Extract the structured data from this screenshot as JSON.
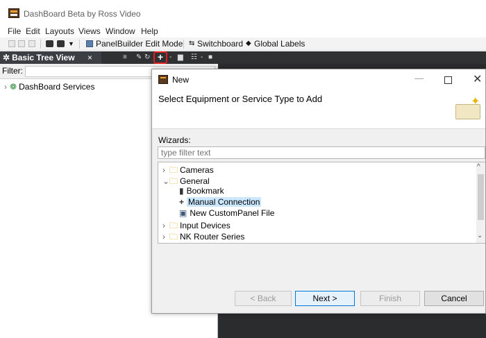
{
  "app": {
    "title": "DashBoard Beta by Ross Video"
  },
  "menu": [
    "File",
    "Edit",
    "Layouts",
    "Views",
    "Window",
    "Help"
  ],
  "toolbar": {
    "panelbuilder": "PanelBuilder Edit Mode",
    "switchboard": "Switchboard",
    "global_labels": "Global Labels"
  },
  "panel": {
    "tab_label": "Basic Tree View",
    "tab_close": "×",
    "filter_label": "Filter:",
    "tree_items": [
      {
        "label": "DashBoard Services"
      }
    ]
  },
  "dialog": {
    "title": "New",
    "heading": "Select Equipment or Service Type to Add",
    "wizards_label": "Wizards:",
    "filter_placeholder": "type filter text",
    "items": [
      {
        "label": "Cameras",
        "type": "folder",
        "expanded": false
      },
      {
        "label": "General",
        "type": "folder",
        "expanded": true
      },
      {
        "label": "Bookmark",
        "type": "bookmark-icon"
      },
      {
        "label": "Manual Connection",
        "type": "plus-icon",
        "selected": true
      },
      {
        "label": "New CustomPanel File",
        "type": "panel-file-icon"
      },
      {
        "label": "Input Devices",
        "type": "folder",
        "expanded": false
      },
      {
        "label": "NK Router Series",
        "type": "folder",
        "expanded": false
      }
    ],
    "buttons": {
      "back": "< Back",
      "next": "Next >",
      "finish": "Finish",
      "cancel": "Cancel"
    }
  },
  "colors": {
    "panel_dark": "#2f3133",
    "selection": "#cce8ff",
    "highlight_border": "#e02020",
    "primary_border": "#0078d7"
  }
}
